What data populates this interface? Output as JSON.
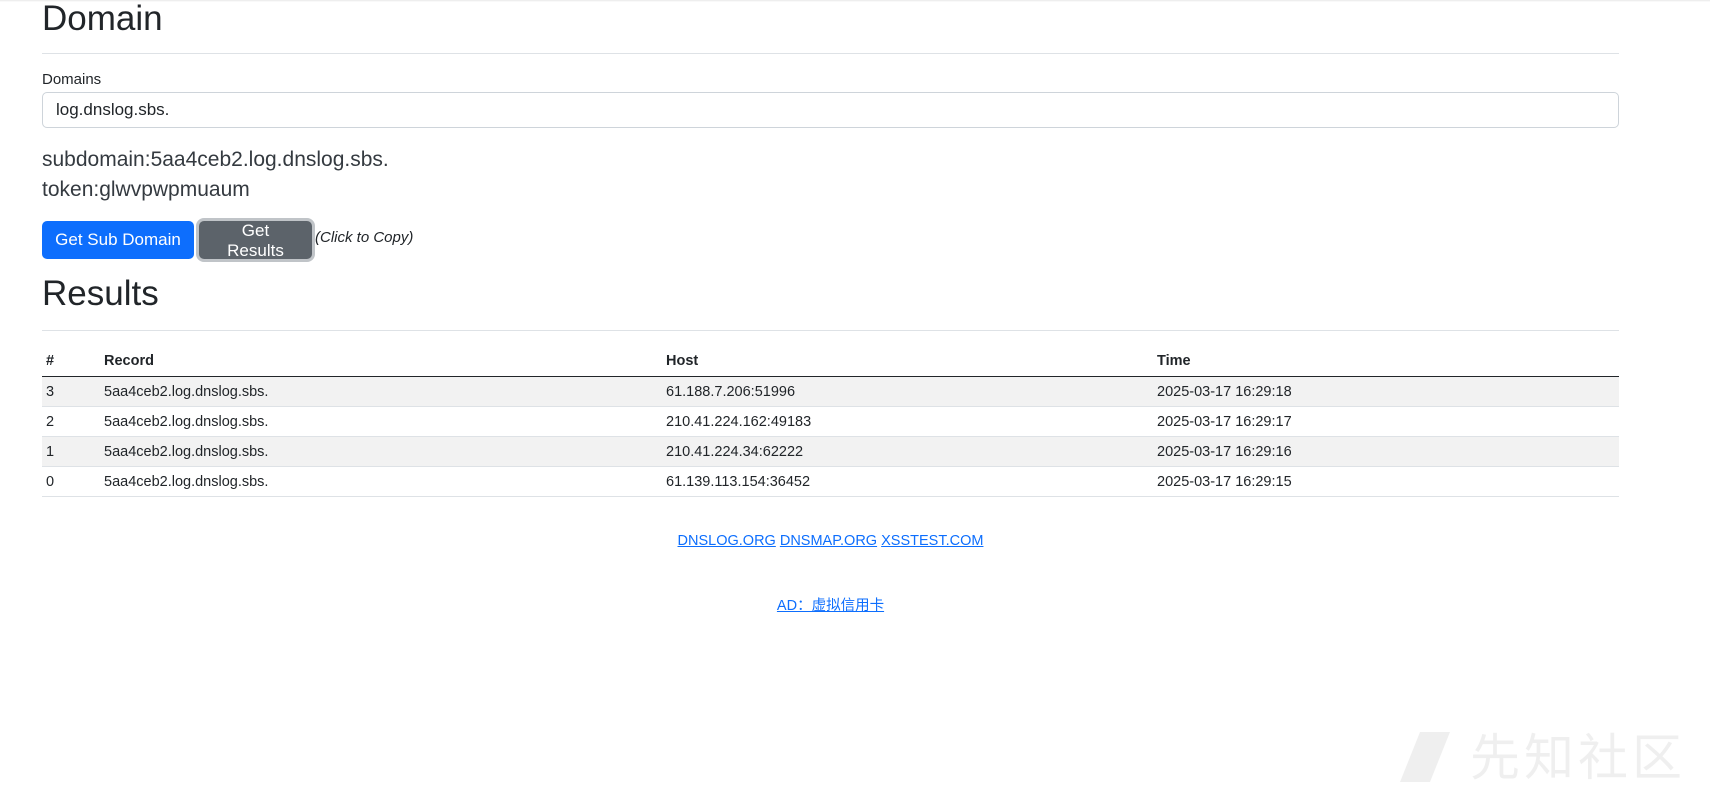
{
  "domain_section": {
    "title": "Domain",
    "domains_label": "Domains",
    "domains_value": "log.dnslog.sbs.",
    "subdomain_text": "subdomain:5aa4ceb2.log.dnslog.sbs.",
    "token_text": "token:glwvpwpmuaum",
    "get_sub_domain_label": "Get Sub Domain",
    "get_results_label": "Get Results",
    "copy_hint": "(Click to Copy)"
  },
  "results_section": {
    "title": "Results",
    "columns": [
      "#",
      "Record",
      "Host",
      "Time"
    ],
    "rows": [
      {
        "id": "3",
        "record": "5aa4ceb2.log.dnslog.sbs.",
        "host": "61.188.7.206:51996",
        "time": "2025-03-17 16:29:18"
      },
      {
        "id": "2",
        "record": "5aa4ceb2.log.dnslog.sbs.",
        "host": "210.41.224.162:49183",
        "time": "2025-03-17 16:29:17"
      },
      {
        "id": "1",
        "record": "5aa4ceb2.log.dnslog.sbs.",
        "host": "210.41.224.34:62222",
        "time": "2025-03-17 16:29:16"
      },
      {
        "id": "0",
        "record": "5aa4ceb2.log.dnslog.sbs.",
        "host": "61.139.113.154:36452",
        "time": "2025-03-17 16:29:15"
      }
    ]
  },
  "footer": {
    "links": [
      "DNSLOG.ORG",
      "DNSMAP.ORG",
      "XSSTEST.COM"
    ],
    "ad_text": "AD：虚拟信用卡"
  },
  "watermark": {
    "text": "先知社区"
  },
  "colors": {
    "primary": "#0d6efd",
    "secondary": "#5c636a",
    "stripe": "#f2f2f2"
  }
}
